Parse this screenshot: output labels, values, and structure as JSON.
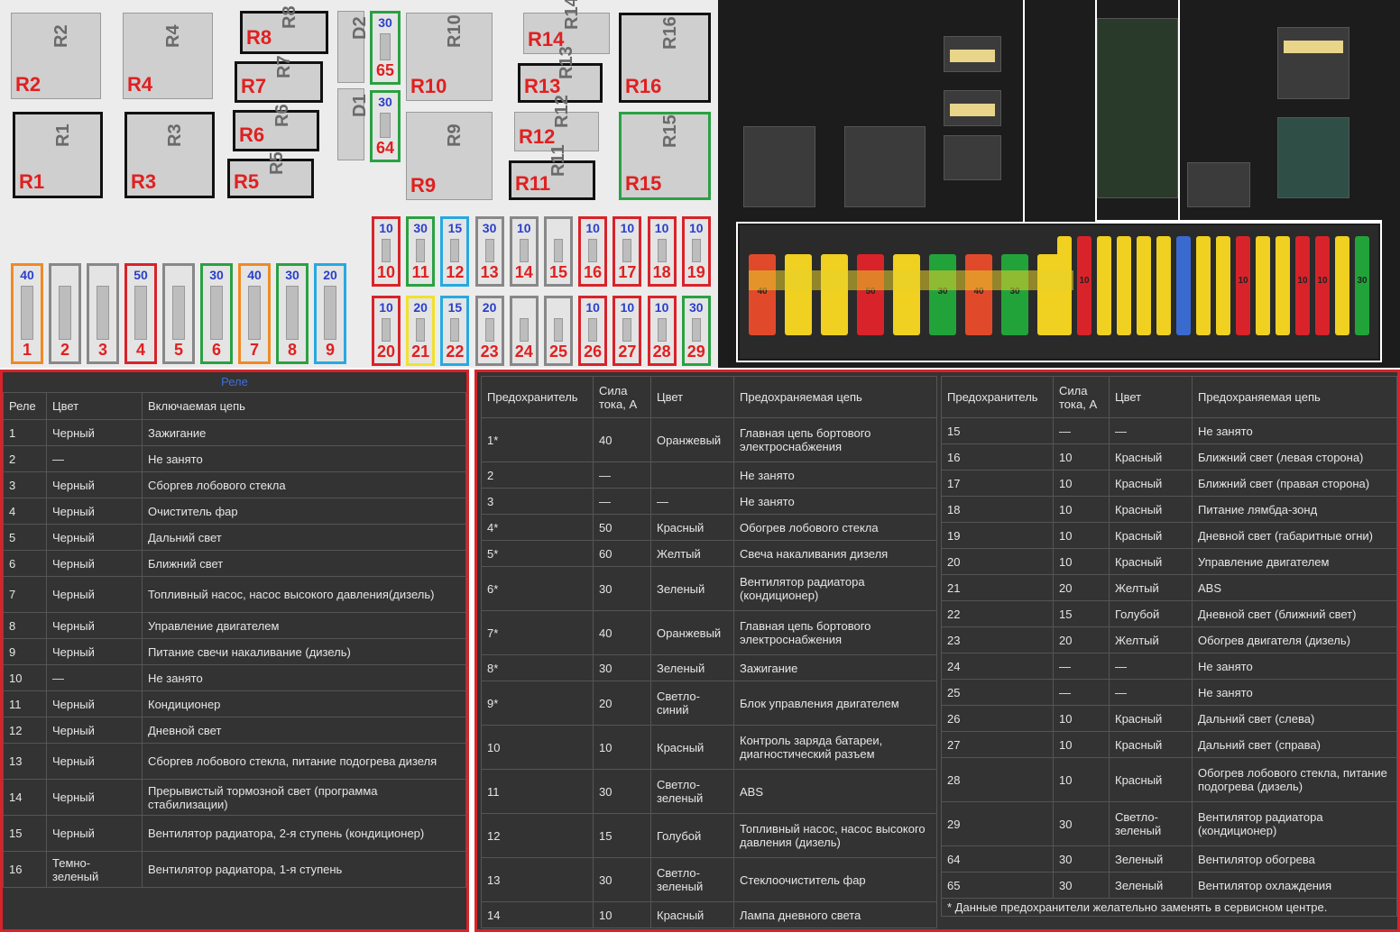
{
  "relays": [
    {
      "code": "R2",
      "label": "R2",
      "black": false,
      "green": false
    },
    {
      "code": "R4",
      "label": "R4",
      "black": false,
      "green": false
    },
    {
      "code": "R8",
      "label": "R8",
      "black": true,
      "green": false
    },
    {
      "code": "R7",
      "label": "R7",
      "black": true,
      "green": false
    },
    {
      "code": "R6",
      "label": "R6",
      "black": true,
      "green": false
    },
    {
      "code": "R5",
      "label": "R5",
      "black": true,
      "green": false
    },
    {
      "code": "R1",
      "label": "R1",
      "black": true,
      "green": false
    },
    {
      "code": "R3",
      "label": "R3",
      "black": true,
      "green": false
    },
    {
      "code": "R10",
      "label": "R10",
      "black": false,
      "green": false
    },
    {
      "code": "R9",
      "label": "R9",
      "black": false,
      "green": false
    },
    {
      "code": "R14",
      "label": "R14",
      "black": false,
      "green": false
    },
    {
      "code": "R13",
      "label": "R13",
      "black": true,
      "green": false
    },
    {
      "code": "R12",
      "label": "R12",
      "black": false,
      "green": false
    },
    {
      "code": "R11",
      "label": "R11",
      "black": true,
      "green": false
    },
    {
      "code": "R16",
      "label": "R16",
      "black": true,
      "green": false
    },
    {
      "code": "R15",
      "label": "R15",
      "black": false,
      "green": true
    },
    {
      "code": "D2",
      "label": "",
      "black": false,
      "green": false
    },
    {
      "code": "D1",
      "label": "",
      "black": false,
      "green": false
    }
  ],
  "fuses_large": [
    {
      "num": "1",
      "amp": "40",
      "color": "#f08a24"
    },
    {
      "num": "2",
      "amp": "",
      "color": "#888888"
    },
    {
      "num": "3",
      "amp": "",
      "color": "#888888"
    },
    {
      "num": "4",
      "amp": "50",
      "color": "#d8232a"
    },
    {
      "num": "5",
      "amp": "",
      "color": "#888888"
    },
    {
      "num": "6",
      "amp": "30",
      "color": "#2aa142"
    },
    {
      "num": "7",
      "amp": "40",
      "color": "#f08a24"
    },
    {
      "num": "8",
      "amp": "30",
      "color": "#2aa142"
    },
    {
      "num": "9",
      "amp": "20",
      "color": "#27a9e1"
    }
  ],
  "fuses_side": [
    {
      "num": "65",
      "amp": "30",
      "color": "#2aa142"
    },
    {
      "num": "64",
      "amp": "30",
      "color": "#2aa142"
    }
  ],
  "fuses_top": [
    {
      "num": "10",
      "amp": "10",
      "color": "#d8232a"
    },
    {
      "num": "11",
      "amp": "30",
      "color": "#2aa142"
    },
    {
      "num": "12",
      "amp": "15",
      "color": "#27a9e1"
    },
    {
      "num": "13",
      "amp": "30",
      "color": "#888888"
    },
    {
      "num": "14",
      "amp": "10",
      "color": "#888888"
    },
    {
      "num": "15",
      "amp": "",
      "color": "#888888"
    },
    {
      "num": "16",
      "amp": "10",
      "color": "#d8232a"
    },
    {
      "num": "17",
      "amp": "10",
      "color": "#d8232a"
    },
    {
      "num": "18",
      "amp": "10",
      "color": "#d8232a"
    },
    {
      "num": "19",
      "amp": "10",
      "color": "#d8232a"
    }
  ],
  "fuses_bottom": [
    {
      "num": "20",
      "amp": "10",
      "color": "#d8232a"
    },
    {
      "num": "21",
      "amp": "20",
      "color": "#f1e12e"
    },
    {
      "num": "22",
      "amp": "15",
      "color": "#27a9e1"
    },
    {
      "num": "23",
      "amp": "20",
      "color": "#888888"
    },
    {
      "num": "24",
      "amp": "",
      "color": "#888888"
    },
    {
      "num": "25",
      "amp": "",
      "color": "#888888"
    },
    {
      "num": "26",
      "amp": "10",
      "color": "#d8232a"
    },
    {
      "num": "27",
      "amp": "10",
      "color": "#d8232a"
    },
    {
      "num": "28",
      "amp": "10",
      "color": "#d8232a"
    },
    {
      "num": "29",
      "amp": "30",
      "color": "#2aa142"
    }
  ],
  "photo_fuses": [
    {
      "text": "40",
      "color": "#e04a2a"
    },
    {
      "text": "",
      "color": "#f0d020"
    },
    {
      "text": "",
      "color": "#f0d020"
    },
    {
      "text": "50",
      "color": "#d8232a"
    },
    {
      "text": "",
      "color": "#f0d020"
    },
    {
      "text": "30",
      "color": "#22a33a"
    },
    {
      "text": "40",
      "color": "#e04a2a"
    },
    {
      "text": "30",
      "color": "#22a33a"
    },
    {
      "text": "",
      "color": "#f0d020"
    },
    {
      "text": "",
      "color": "#f0d020"
    },
    {
      "text": "10",
      "color": "#d8232a"
    },
    {
      "text": "",
      "color": "#f0d020"
    },
    {
      "text": "",
      "color": "#f0d020"
    },
    {
      "text": "",
      "color": "#f0d020"
    },
    {
      "text": "",
      "color": "#f0d020"
    },
    {
      "text": "",
      "color": "#3a6ad0"
    },
    {
      "text": "",
      "color": "#f0d020"
    },
    {
      "text": "",
      "color": "#f0d020"
    },
    {
      "text": "10",
      "color": "#d8232a"
    },
    {
      "text": "",
      "color": "#f0d020"
    },
    {
      "text": "",
      "color": "#f0d020"
    },
    {
      "text": "10",
      "color": "#d8232a"
    },
    {
      "text": "10",
      "color": "#d8232a"
    },
    {
      "text": "",
      "color": "#f0d020"
    },
    {
      "text": "30",
      "color": "#22a33a"
    }
  ],
  "relay_table": {
    "caption": "Реле",
    "headers": [
      "Реле",
      "Цвет",
      "Включаемая цепь"
    ],
    "rows": [
      [
        "1",
        "Черный",
        "Зажигание"
      ],
      [
        "2",
        "—",
        "Не занято"
      ],
      [
        "3",
        "Черный",
        "Сборгев лобового стекла"
      ],
      [
        "4",
        "Черный",
        "Очиститель фар"
      ],
      [
        "5",
        "Черный",
        "Дальний свет"
      ],
      [
        "6",
        "Черный",
        "Ближний свет"
      ],
      [
        "7",
        "Черный",
        "Топливный насос, насос высокого давления(дизель)"
      ],
      [
        "8",
        "Черный",
        "Управление двигателем"
      ],
      [
        "9",
        "Черный",
        "Питание свечи накаливание (дизель)"
      ],
      [
        "10",
        "—",
        "Не занято"
      ],
      [
        "11",
        "Черный",
        "Кондиционер"
      ],
      [
        "12",
        "Черный",
        "Дневной свет"
      ],
      [
        "13",
        "Черный",
        "Сборгев лобового стекла, питание подогрева дизеля"
      ],
      [
        "14",
        "Черный",
        "Прерывистый тормозной свет (программа стабилизации)"
      ],
      [
        "15",
        "Черный",
        "Вентилятор радиатора, 2-я ступень (кондиционер)"
      ],
      [
        "16",
        "Темно-зеленый",
        "Вентилятор радиатора, 1-я ступень"
      ]
    ]
  },
  "fuse_table_left": {
    "headers": [
      "Предохранитель",
      "Сила тока, А",
      "Цвет",
      "Предохраняемая цепь"
    ],
    "rows": [
      [
        "1*",
        "40",
        "Оранжевый",
        "Главная цепь бортового электроснабжения"
      ],
      [
        "2",
        "—",
        "",
        "Не занято"
      ],
      [
        "3",
        "—",
        "—",
        "Не занято"
      ],
      [
        "4*",
        "50",
        "Красный",
        "Обогрев лобового стекла"
      ],
      [
        "5*",
        "60",
        "Желтый",
        "Свеча накаливания дизеля"
      ],
      [
        "6*",
        "30",
        "Зеленый",
        "Вентилятор радиатора (кондиционер)"
      ],
      [
        "7*",
        "40",
        "Оранжевый",
        "Главная цепь бортового электроснабжения"
      ],
      [
        "8*",
        "30",
        "Зеленый",
        "Зажигание"
      ],
      [
        "9*",
        "20",
        "Светло-синий",
        "Блок управления двигателем"
      ],
      [
        "10",
        "10",
        "Красный",
        "Контроль заряда батареи, диагностический разъем"
      ],
      [
        "11",
        "30",
        "Светло-зеленый",
        "ABS"
      ],
      [
        "12",
        "15",
        "Голубой",
        "Топливный насос, насос высокого давления (дизель)"
      ],
      [
        "13",
        "30",
        "Светло-зеленый",
        "Стеклоочиститель фар"
      ],
      [
        "14",
        "10",
        "Красный",
        "Лампа дневного света"
      ]
    ]
  },
  "fuse_table_right": {
    "headers": [
      "Предохранитель",
      "Сила тока, А",
      "Цвет",
      "Предохраняемая цепь"
    ],
    "rows": [
      [
        "15",
        "—",
        "—",
        "Не занято"
      ],
      [
        "16",
        "10",
        "Красный",
        "Ближний свет (левая сторона)"
      ],
      [
        "17",
        "10",
        "Красный",
        "Ближний свет (правая сторона)"
      ],
      [
        "18",
        "10",
        "Красный",
        "Питание лямбда-зонд"
      ],
      [
        "19",
        "10",
        "Красный",
        "Дневной свет (габаритные огни)"
      ],
      [
        "20",
        "10",
        "Красный",
        "Управление двигателем"
      ],
      [
        "21",
        "20",
        "Желтый",
        "ABS"
      ],
      [
        "22",
        "15",
        "Голубой",
        "Дневной свет (ближний свет)"
      ],
      [
        "23",
        "20",
        "Желтый",
        "Обогрев двигателя (дизель)"
      ],
      [
        "24",
        "—",
        "—",
        "Не занято"
      ],
      [
        "25",
        "—",
        "—",
        "Не занято"
      ],
      [
        "26",
        "10",
        "Красный",
        "Дальний свет (слева)"
      ],
      [
        "27",
        "10",
        "Красный",
        "Дальний свет (справа)"
      ],
      [
        "28",
        "10",
        "Красный",
        "Обогрев лобового стекла, питание подогрева (дизель)"
      ],
      [
        "29",
        "30",
        "Светло-зеленый",
        "Вентилятор радиатора (кондиционер)"
      ],
      [
        "64",
        "30",
        "Зеленый",
        "Вентилятор обогрева"
      ],
      [
        "65",
        "30",
        "Зеленый",
        "Вентилятор охлаждения"
      ]
    ],
    "note": "* Данные предохранители желательно заменять в сервисном центре."
  }
}
